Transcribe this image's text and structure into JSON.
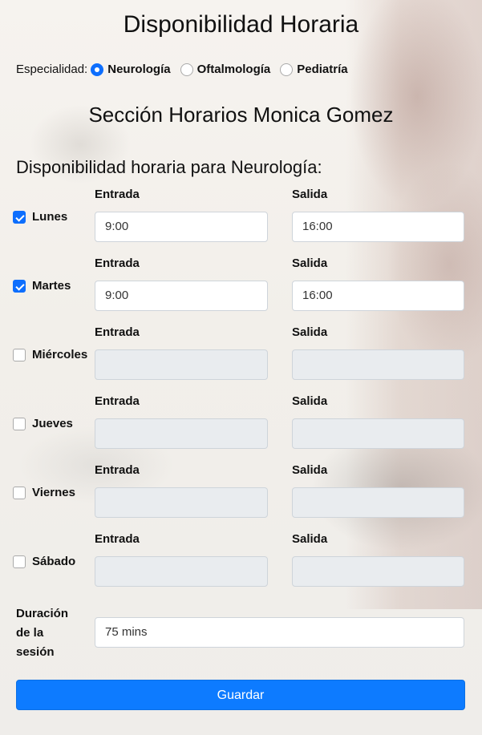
{
  "page": {
    "title": "Disponibilidad Horaria",
    "specialty_label": "Especialidad:",
    "specialties": [
      {
        "label": "Neurología",
        "selected": true
      },
      {
        "label": "Oftalmología",
        "selected": false
      },
      {
        "label": "Pediatría",
        "selected": false
      }
    ],
    "section_title": "Sección Horarios Monica Gomez",
    "availability_heading": "Disponibilidad horaria para Neurología:"
  },
  "schedule": {
    "entry_label": "Entrada",
    "exit_label": "Salida",
    "days": [
      {
        "name": "Lunes",
        "checked": true,
        "entrada": "9:00",
        "salida": "16:00"
      },
      {
        "name": "Martes",
        "checked": true,
        "entrada": "9:00",
        "salida": "16:00"
      },
      {
        "name": "Miércoles",
        "checked": false,
        "entrada": "",
        "salida": ""
      },
      {
        "name": "Jueves",
        "checked": false,
        "entrada": "",
        "salida": ""
      },
      {
        "name": "Viernes",
        "checked": false,
        "entrada": "",
        "salida": ""
      },
      {
        "name": "Sábado",
        "checked": false,
        "entrada": "",
        "salida": ""
      }
    ]
  },
  "duration": {
    "label": "Duración de la sesión",
    "value": "75 mins"
  },
  "actions": {
    "save_label": "Guardar"
  },
  "colors": {
    "primary": "#0d7bff",
    "disabled_field": "#e9ecef"
  }
}
